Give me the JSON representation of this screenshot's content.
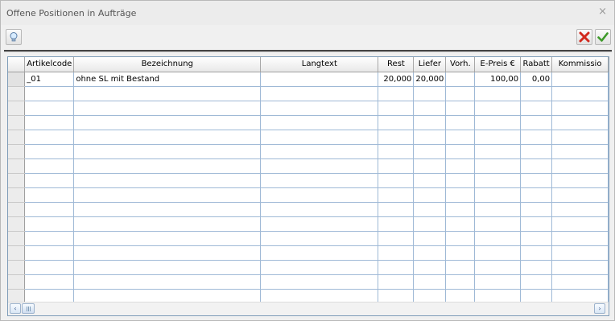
{
  "window": {
    "title": "Offene Positionen in Aufträge",
    "close_glyph": "×"
  },
  "toolbar": {
    "left_icon": "lightbulb-icon",
    "cancel_icon": "red-x-icon",
    "ok_icon": "green-check-icon"
  },
  "grid": {
    "columns": [
      "",
      "Artikelcode",
      "Bezeichnung",
      "Langtext",
      "Rest",
      "Liefer",
      "Vorh.",
      "E-Preis €",
      "Rabatt",
      "Kommissio"
    ],
    "rows": [
      {
        "artikelcode": "_01",
        "bezeichnung": "ohne SL mit Bestand",
        "langtext": "",
        "rest": "20,000",
        "liefer": "20,000",
        "vorh": "",
        "epreis": "100,00",
        "rabatt": "0,00",
        "kommission": ""
      }
    ],
    "empty_rows": 15
  },
  "scrollbar": {
    "left_arrow": "‹",
    "right_arrow": "›"
  }
}
